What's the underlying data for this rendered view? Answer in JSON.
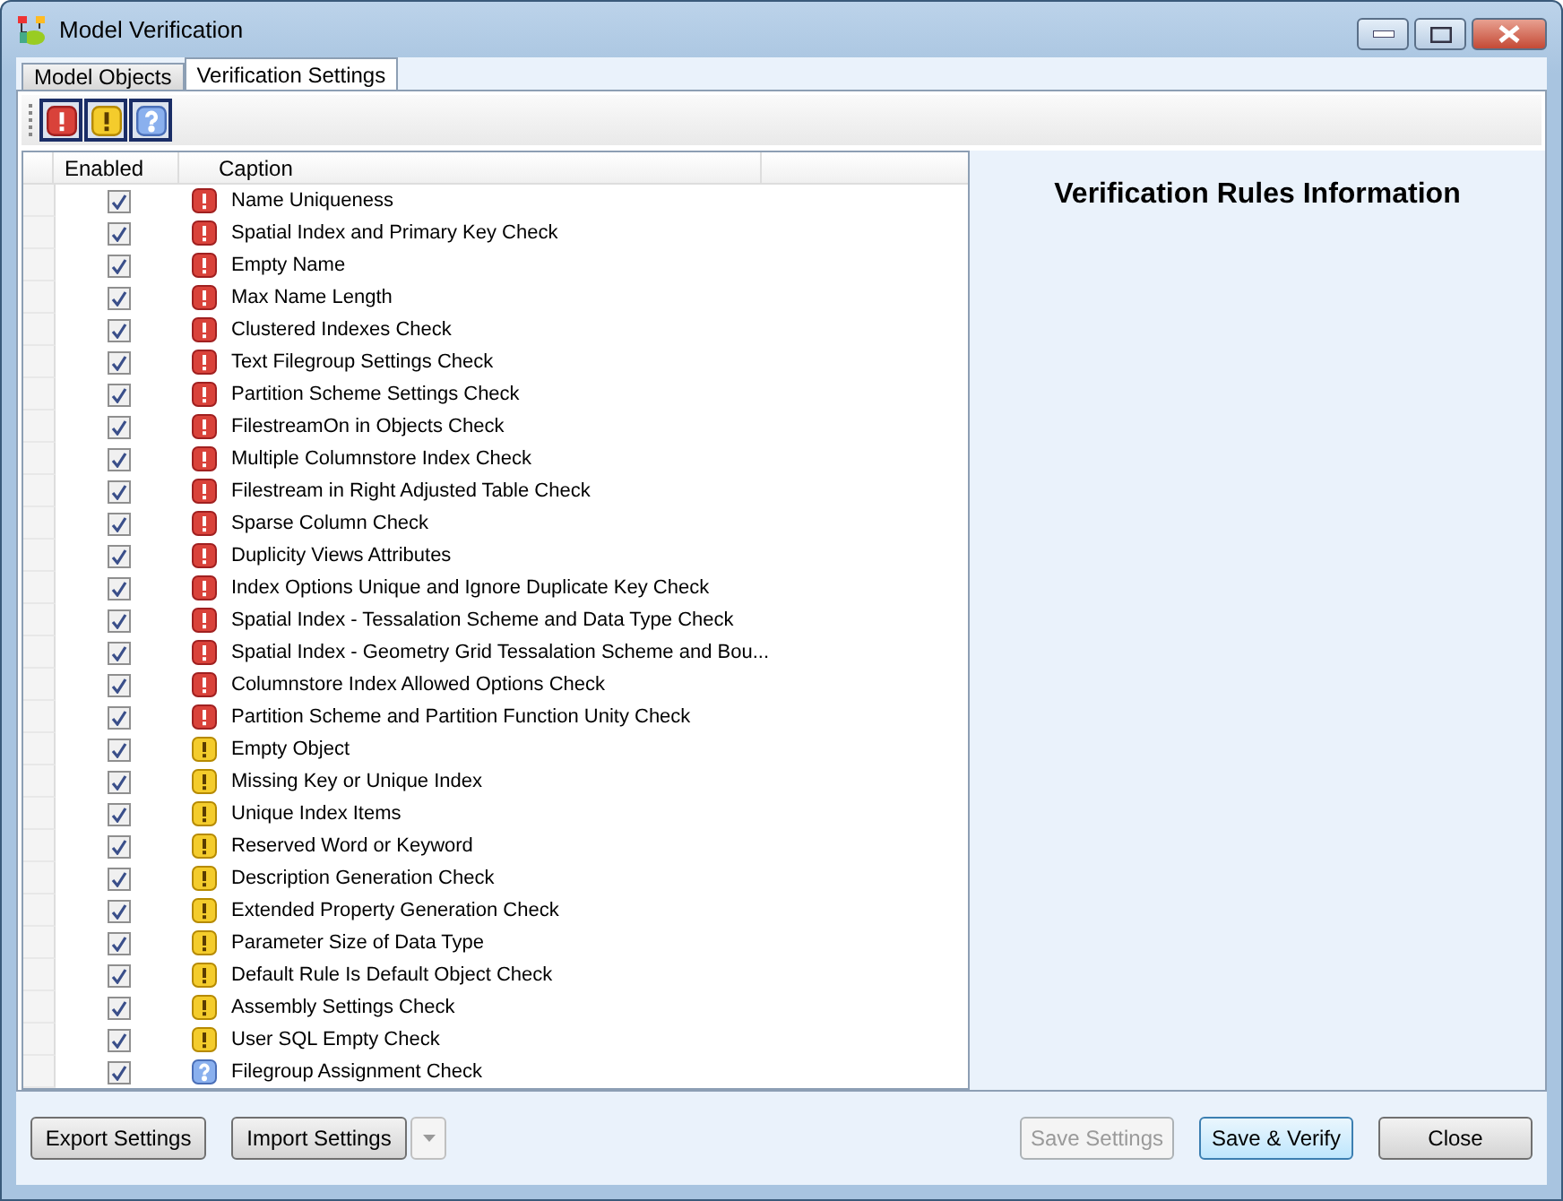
{
  "window": {
    "title": "Model Verification"
  },
  "tabs": [
    {
      "label": "Model Objects",
      "selected": false
    },
    {
      "label": "Verification Settings",
      "selected": true
    }
  ],
  "filters": [
    {
      "kind": "error",
      "selected": true
    },
    {
      "kind": "warning",
      "selected": true
    },
    {
      "kind": "info",
      "selected": true
    }
  ],
  "grid": {
    "columns": [
      "Enabled",
      "Caption"
    ],
    "rows": [
      {
        "enabled": true,
        "kind": "error",
        "caption": "Name Uniqueness"
      },
      {
        "enabled": true,
        "kind": "error",
        "caption": "Spatial Index and Primary Key Check"
      },
      {
        "enabled": true,
        "kind": "error",
        "caption": "Empty Name"
      },
      {
        "enabled": true,
        "kind": "error",
        "caption": "Max Name Length"
      },
      {
        "enabled": true,
        "kind": "error",
        "caption": "Clustered Indexes Check"
      },
      {
        "enabled": true,
        "kind": "error",
        "caption": "Text Filegroup Settings Check"
      },
      {
        "enabled": true,
        "kind": "error",
        "caption": "Partition Scheme Settings Check"
      },
      {
        "enabled": true,
        "kind": "error",
        "caption": "FilestreamOn in Objects Check"
      },
      {
        "enabled": true,
        "kind": "error",
        "caption": "Multiple Columnstore Index Check"
      },
      {
        "enabled": true,
        "kind": "error",
        "caption": "Filestream in Right Adjusted Table Check"
      },
      {
        "enabled": true,
        "kind": "error",
        "caption": "Sparse Column Check"
      },
      {
        "enabled": true,
        "kind": "error",
        "caption": "Duplicity Views Attributes"
      },
      {
        "enabled": true,
        "kind": "error",
        "caption": "Index Options Unique and Ignore Duplicate Key Check"
      },
      {
        "enabled": true,
        "kind": "error",
        "caption": "Spatial Index - Tessalation Scheme and Data Type Check"
      },
      {
        "enabled": true,
        "kind": "error",
        "caption": "Spatial Index - Geometry Grid Tessalation Scheme and Bou..."
      },
      {
        "enabled": true,
        "kind": "error",
        "caption": "Columnstore Index Allowed Options Check"
      },
      {
        "enabled": true,
        "kind": "error",
        "caption": "Partition Scheme and Partition Function Unity Check"
      },
      {
        "enabled": true,
        "kind": "warning",
        "caption": "Empty Object"
      },
      {
        "enabled": true,
        "kind": "warning",
        "caption": "Missing Key or Unique Index"
      },
      {
        "enabled": true,
        "kind": "warning",
        "caption": "Unique Index Items"
      },
      {
        "enabled": true,
        "kind": "warning",
        "caption": "Reserved Word or Keyword"
      },
      {
        "enabled": true,
        "kind": "warning",
        "caption": "Description Generation Check"
      },
      {
        "enabled": true,
        "kind": "warning",
        "caption": "Extended Property Generation Check"
      },
      {
        "enabled": true,
        "kind": "warning",
        "caption": "Parameter Size of Data Type"
      },
      {
        "enabled": true,
        "kind": "warning",
        "caption": "Default Rule Is Default Object Check"
      },
      {
        "enabled": true,
        "kind": "warning",
        "caption": "Assembly Settings Check"
      },
      {
        "enabled": true,
        "kind": "warning",
        "caption": "User SQL Empty Check"
      },
      {
        "enabled": true,
        "kind": "info",
        "caption": "Filegroup Assignment Check"
      }
    ]
  },
  "info_panel": {
    "title": "Verification Rules Information"
  },
  "buttons_left": [
    {
      "label": "Export Settings",
      "disabled": false
    },
    {
      "label": "Import Settings",
      "disabled": false
    }
  ],
  "buttons_right": [
    {
      "label": "Save Settings",
      "disabled": true
    },
    {
      "label": "Save & Verify",
      "disabled": false,
      "default": true
    },
    {
      "label": "Close",
      "disabled": false
    }
  ]
}
